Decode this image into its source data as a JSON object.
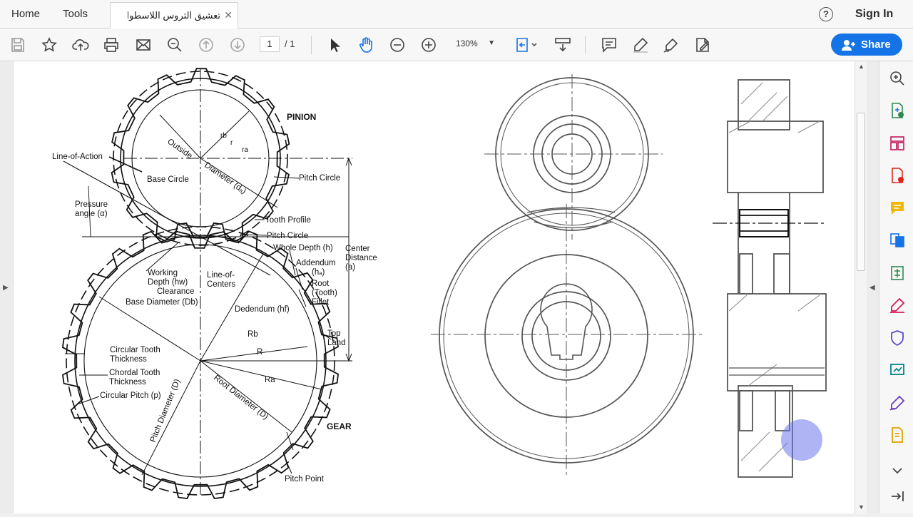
{
  "menu": {
    "home": "Home",
    "tools": "Tools",
    "help_icon": "?",
    "sign_in": "Sign In"
  },
  "tab": {
    "title": "تعشيق التروس اللاسطوانية...",
    "close": "✕"
  },
  "toolbar": {
    "page_current": "1",
    "page_total": "/ 1",
    "zoom": "130%",
    "share": "Share",
    "icons": [
      "save-icon",
      "star-icon",
      "upload-icon",
      "print-icon",
      "email-icon",
      "zoom-search-icon",
      "page-up-icon",
      "page-down-icon",
      "select-arrow-icon",
      "hand-icon",
      "zoom-out-icon",
      "zoom-in-icon",
      "fit-page-icon",
      "scroll-mode-icon",
      "comment-icon",
      "highlight-pen-icon",
      "sign-icon",
      "edit-pdf-icon"
    ]
  },
  "drawing": {
    "labels": {
      "pinion": "PINION",
      "gear": "GEAR",
      "line_of_action": "Line-of-Action",
      "base_circle": "Base Circle",
      "pressure": "Pressure",
      "angle": "angle (α)",
      "outside": "Outside",
      "diameter_da": "Diameter (dₐ)",
      "pitch_circle_top": "Pitch Circle",
      "tooth_profile": "Tooth Profile",
      "pitch_circle_mid": "Pitch Circle",
      "whole_depth": "Whole Depth (h)",
      "center": "Center",
      "distance": "Distance",
      "a": "(a)",
      "addendum": "Addendum",
      "ha": "(hₐ)",
      "working": "Working",
      "depth_hw": "Depth (hw)",
      "clearance": "Clearance",
      "line_of": "Line-of-",
      "centers": "Centers",
      "base_diameter": "Base Diameter (Db)",
      "root": "Root",
      "tooth": "(Tooth)",
      "fillet": "Fillet",
      "dedendum": "Dedendum (hf)",
      "top": "Top",
      "land": "Land",
      "rb": "Rb",
      "R": "R",
      "ra": "Ra",
      "circ_tooth": "Circular Tooth",
      "thickness1": "Thickness",
      "chordal_tooth": "Chordal Tooth",
      "thickness2": "Thickness",
      "circular_pitch": "Circular Pitch (p)",
      "pitch_diameter": "Pitch Diameter (D)",
      "root_diameter": "Root Diameter (D)",
      "pitch_point": "Pitch Point",
      "r_b": "rb",
      "r": "r",
      "r_a": "ra"
    }
  },
  "rail": {
    "icons": [
      "zoom-icon",
      "export-pdf-icon",
      "organize-pages-icon",
      "create-pdf-icon",
      "comment-icon",
      "combine-files-icon",
      "compress-icon",
      "fill-sign-icon",
      "protect-icon",
      "send-review-icon",
      "sign-pen-icon",
      "more-tools-icon",
      "expand-icon",
      "collapse-rail-icon"
    ]
  }
}
